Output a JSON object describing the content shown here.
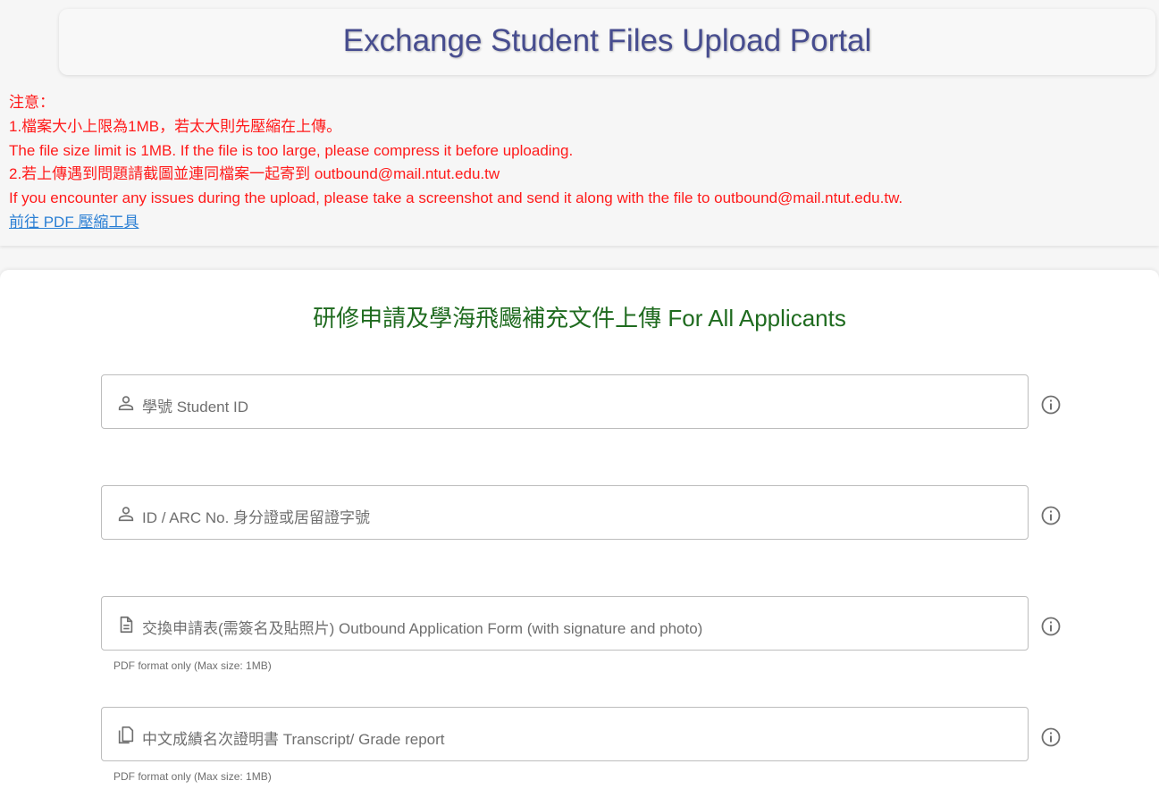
{
  "header": {
    "title": "Exchange Student Files Upload Portal"
  },
  "notice": {
    "lines": [
      "注意：",
      "1.檔案大小上限為1MB，若太大則先壓縮在上傳。",
      "The file size limit is 1MB. If the file is too large, please compress it before uploading.",
      "2.若上傳遇到問題請截圖並連同檔案一起寄到 outbound@mail.ntut.edu.tw",
      "If you encounter any issues during the upload, please take a screenshot and send it along with the file to outbound@mail.ntut.edu.tw."
    ],
    "link": "前往 PDF 壓縮工具"
  },
  "section": {
    "title_zh": "研修申請及學海飛颺補充文件上傳",
    "title_en": "For All Applicants"
  },
  "fields": [
    {
      "icon": "person-icon",
      "label": "學號 Student ID",
      "hint": ""
    },
    {
      "icon": "person-icon",
      "label": "ID / ARC No. 身分證或居留證字號",
      "hint": ""
    },
    {
      "icon": "file-document-icon",
      "label": "交換申請表(需簽名及貼照片) Outbound Application Form (with signature and photo)",
      "hint": "PDF format only (Max size: 1MB)"
    },
    {
      "icon": "file-copy-icon",
      "label": "中文成績名次證明書 Transcript/ Grade report",
      "hint": "PDF format only (Max size: 1MB)"
    }
  ],
  "colors": {
    "title": "#474d8f",
    "notice": "#ff1a1a",
    "link": "#2a7fd4",
    "section_title": "#1f6b1f"
  }
}
